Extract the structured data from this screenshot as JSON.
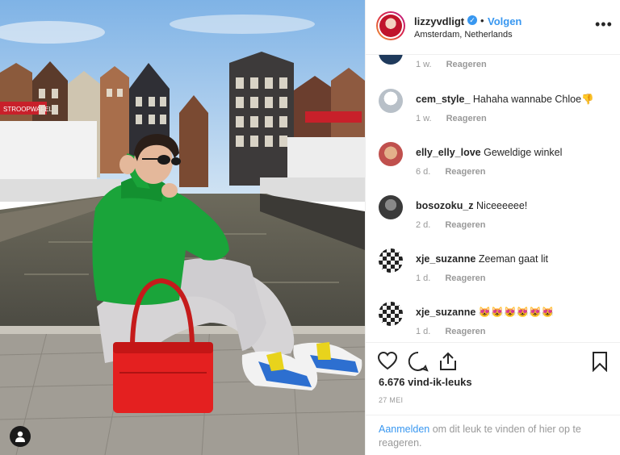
{
  "post": {
    "username": "lizzyvdligt",
    "verified_icon": "verified-badge-icon",
    "separator": "•",
    "follow_label": "Volgen",
    "location": "Amsterdam, Netherlands",
    "more_icon": "more-options-icon"
  },
  "photo": {
    "sign_text": "STROOPWAFEL"
  },
  "comments": {
    "top_partial": {
      "time": "1 w.",
      "reply": "Reageren"
    },
    "items": [
      {
        "user": "cem_style_",
        "text": "Hahaha wannabe Chloe",
        "emoji": "👎",
        "time": "1 w.",
        "reply": "Reageren",
        "avatar_color": "#b8c0c8"
      },
      {
        "user": "elly_elly_love",
        "text": "Geweldige winkel",
        "emoji": "",
        "time": "6 d.",
        "reply": "Reageren",
        "avatar_color": "#c0504d"
      },
      {
        "user": "bosozoku_z",
        "text": "Niceeeeee!",
        "emoji": "",
        "time": "2 d.",
        "reply": "Reageren",
        "avatar_color": "#4a4a4a"
      },
      {
        "user": "xje_suzanne",
        "text": "Zeeman gaat lit",
        "emoji": "",
        "time": "1 d.",
        "reply": "Reageren",
        "avatar_color": "#555555"
      },
      {
        "user": "xje_suzanne",
        "text": "",
        "emoji": "😻😻😻😻😻😻",
        "time": "1 d.",
        "reply": "Reageren",
        "avatar_color": "#555555"
      }
    ]
  },
  "actions": {
    "likes": "6.676 vind-ik-leuks",
    "date": "27 MEI"
  },
  "login": {
    "link": "Aanmelden",
    "text": " om dit leuk te vinden of hier op te reageren."
  },
  "colors": {
    "accent": "#3897f0",
    "text": "#262626",
    "muted": "#999999"
  }
}
